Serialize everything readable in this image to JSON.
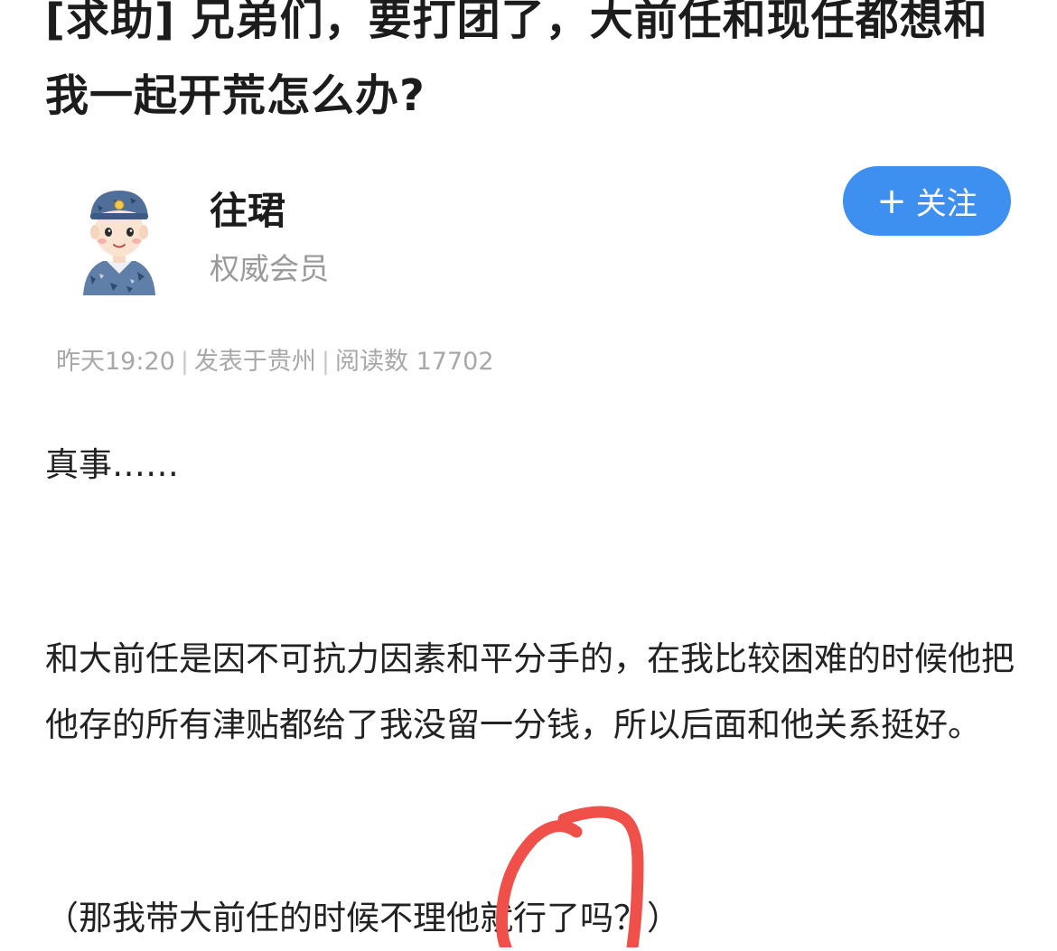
{
  "post": {
    "title": "[求助] 兄弟们，要打团了，大前任和现任都想和我一起开荒怎么办?"
  },
  "author": {
    "name": "往珺",
    "role": "权威会员",
    "avatar_icon": "soldier-avatar-icon"
  },
  "follow_button": {
    "plus": "+",
    "label": "关注",
    "color": "#3d8ff0"
  },
  "meta": {
    "time": "昨天19:20",
    "location": "发表于贵州",
    "reads": "阅读数 17702"
  },
  "content": {
    "paragraph_1": "真事……",
    "paragraph_2": "和大前任是因不可抗力因素和平分手的，在我比较困难的时候他把他存的所有津贴都给了我没留一分钱，所以后面和他关系挺好。",
    "paragraph_3": "（那我带大前任的时候不理他就行了吗？）"
  },
  "annotation": {
    "circle_color": "#f0504a"
  }
}
